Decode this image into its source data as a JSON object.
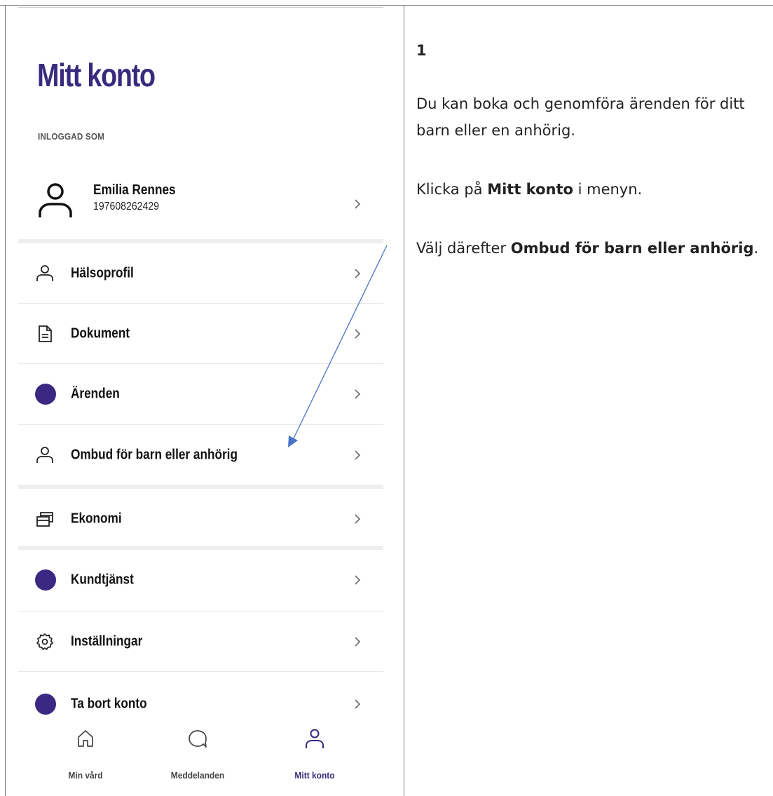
{
  "screen": {
    "title": "Mitt konto",
    "logged_in_label": "INLOGGAD SOM",
    "user": {
      "name": "Emilia Rennes",
      "personal_number": "197608262429"
    },
    "menu": [
      {
        "label": "Hälsoprofil",
        "icon": "person-icon"
      },
      {
        "label": "Dokument",
        "icon": "document-icon"
      },
      {
        "label": "Ärenden",
        "icon": "dot-icon"
      },
      {
        "label": "Ombud för barn eller anhörig",
        "icon": "person-icon"
      },
      {
        "label": "Ekonomi",
        "icon": "cards-icon"
      },
      {
        "label": "Kundtjänst",
        "icon": "dot-icon"
      },
      {
        "label": "Inställningar",
        "icon": "gear-icon"
      },
      {
        "label": "Ta bort konto",
        "icon": "dot-icon"
      }
    ],
    "bottom_nav": [
      {
        "label": "Min vård",
        "icon": "home-icon",
        "active": false
      },
      {
        "label": "Meddelanden",
        "icon": "chat-bubble-icon",
        "active": false
      },
      {
        "label": "Mitt konto",
        "icon": "person-icon",
        "active": true
      }
    ],
    "accent_color": "#3b2882"
  },
  "instructions": {
    "step": "1",
    "intro": "Du kan boka och genomföra ärenden för ditt barn eller en anhörig.",
    "line2_pre": "Klicka på ",
    "line2_bold": "Mitt konto",
    "line2_post": " i menyn.",
    "line3_pre": "Välj därefter ",
    "line3_bold": "Ombud för barn eller anhörig",
    "line3_post": "."
  }
}
